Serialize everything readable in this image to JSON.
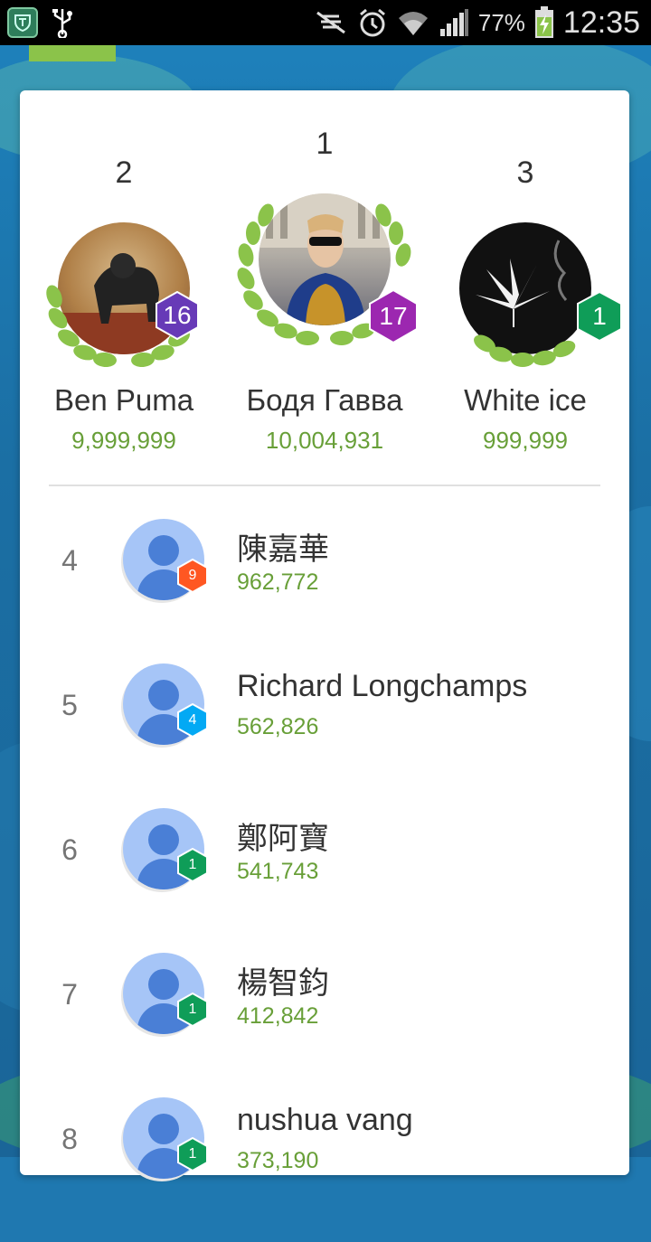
{
  "status_bar": {
    "battery_percent": "77%",
    "clock": "12:35"
  },
  "podium": [
    {
      "rank": "2",
      "name": "Ben Puma",
      "score": "9,999,999",
      "level": "16",
      "level_color": "#673ab7"
    },
    {
      "rank": "1",
      "name": "Бодя Гавва",
      "score": "10,004,931",
      "level": "17",
      "level_color": "#9c27b0"
    },
    {
      "rank": "3",
      "name": "White ice",
      "score": "999,999",
      "level": "1",
      "level_color": "#0f9d58"
    }
  ],
  "leaderboard": [
    {
      "rank": "4",
      "name": "陳嘉華",
      "score": "962,772",
      "level": "9",
      "level_color": "#ff5722"
    },
    {
      "rank": "5",
      "name": "Richard Longchamps",
      "score": "562,826",
      "level": "4",
      "level_color": "#03a9f4"
    },
    {
      "rank": "6",
      "name": "鄭阿寶",
      "score": "541,743",
      "level": "1",
      "level_color": "#0f9d58"
    },
    {
      "rank": "7",
      "name": "楊智鈞",
      "score": "412,842",
      "level": "1",
      "level_color": "#0f9d58"
    },
    {
      "rank": "8",
      "name": "nushua vang",
      "score": "373,190",
      "level": "1",
      "level_color": "#0f9d58"
    }
  ],
  "colors": {
    "score_green": "#689f38",
    "laurel_green": "#8bc34a",
    "avatar_placeholder": "#a6c5f7"
  },
  "icons": [
    "shield-icon",
    "usb-icon",
    "silent-icon",
    "alarm-icon",
    "wifi-icon",
    "signal-icon",
    "battery-charging-icon",
    "laurel-wreath-icon",
    "level-hexagon-icon",
    "default-avatar-icon"
  ]
}
